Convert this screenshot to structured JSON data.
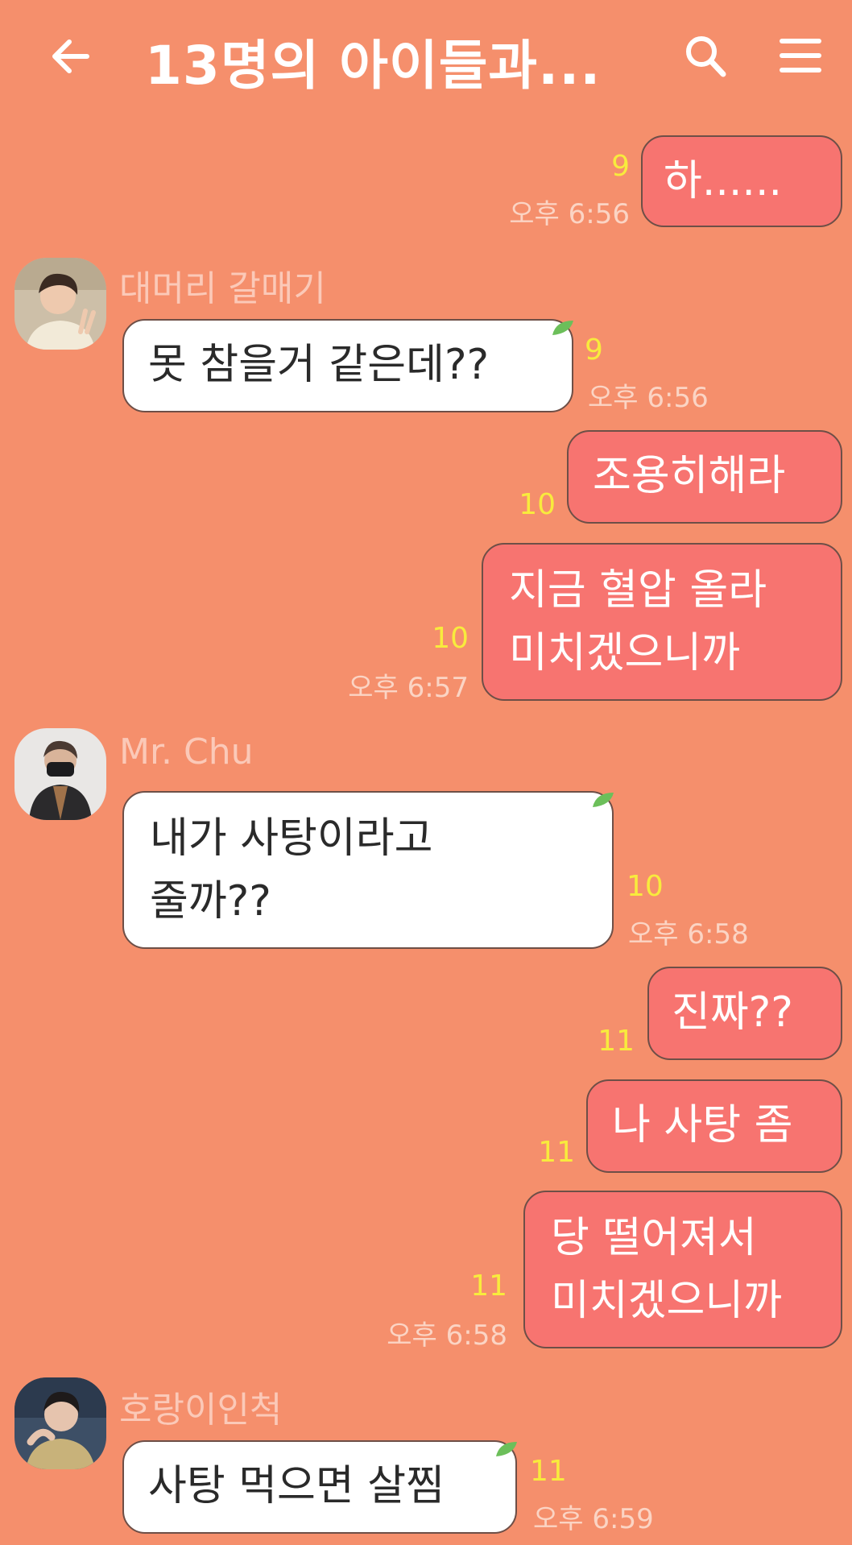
{
  "header": {
    "back_icon": "arrow-left-icon",
    "title": "13명의 아이들과...",
    "search_icon": "search-icon",
    "menu_icon": "hamburger-menu-icon"
  },
  "colors": {
    "background": "#f58f6c",
    "my_bubble": "#f77470",
    "their_bubble": "#ffffff",
    "unread": "#f8eb3d"
  },
  "messages": [
    {
      "id": "m1",
      "side": "me",
      "lines": [
        "하......"
      ],
      "unread": "9",
      "time": "오후 6:56"
    },
    {
      "id": "m2",
      "side": "them",
      "sender": "대머리 갈매기",
      "lines": [
        "못 참을거 같은데??"
      ],
      "unread": "9",
      "time": "오후 6:56"
    },
    {
      "id": "m3",
      "side": "me",
      "lines": [
        "조용히해라"
      ],
      "unread": "10",
      "time": ""
    },
    {
      "id": "m4",
      "side": "me",
      "lines": [
        "지금 혈압 올라",
        "미치겠으니까"
      ],
      "unread": "10",
      "time": "오후 6:57"
    },
    {
      "id": "m5",
      "side": "them",
      "sender": "Mr. Chu",
      "lines": [
        "내가 사탕이라고",
        "줄까??"
      ],
      "unread": "10",
      "time": "오후 6:58"
    },
    {
      "id": "m6",
      "side": "me",
      "lines": [
        "진짜??"
      ],
      "unread": "11",
      "time": ""
    },
    {
      "id": "m7",
      "side": "me",
      "lines": [
        "나 사탕 좀"
      ],
      "unread": "11",
      "time": ""
    },
    {
      "id": "m8",
      "side": "me",
      "lines": [
        "당 떨어져서",
        "미치겠으니까"
      ],
      "unread": "11",
      "time": "오후 6:58"
    },
    {
      "id": "m9",
      "side": "them",
      "sender": "호랑이인척",
      "lines": [
        "사탕 먹으면 살찜"
      ],
      "unread": "11",
      "time": "오후 6:59"
    }
  ]
}
